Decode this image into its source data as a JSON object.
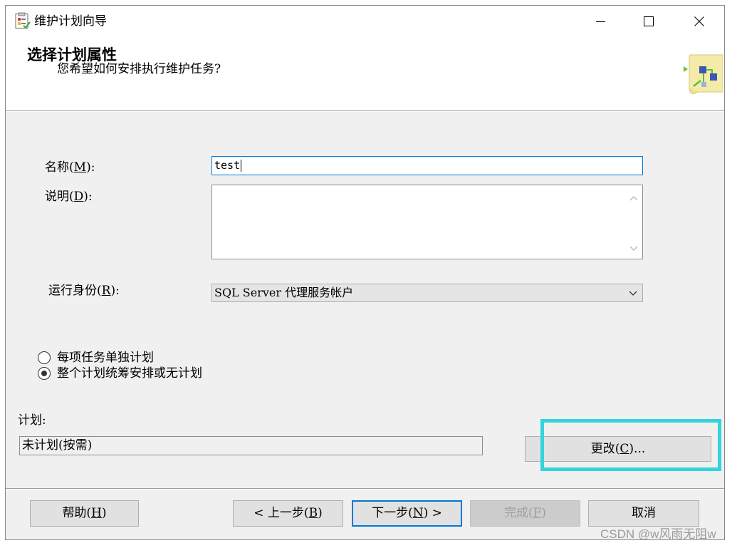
{
  "window": {
    "title": "维护计划向导"
  },
  "header": {
    "title": "选择计划属性",
    "subtitle": "您希望如何安排执行维护任务?"
  },
  "form": {
    "name_label": "名称(M):",
    "name_value": "test",
    "description_label": "说明(D):",
    "description_value": "",
    "run_as_label": "运行身份(R):",
    "run_as_value": "SQL Server 代理服务帐户",
    "schedule_options": [
      {
        "label": "每项任务单独计划",
        "selected": false
      },
      {
        "label": "整个计划统筹安排或无计划",
        "selected": true
      }
    ],
    "schedule_label": "计划:",
    "schedule_value": "未计划(按需)",
    "change_button": "更改(C)..."
  },
  "footer": {
    "help": "帮助(H)",
    "back": "< 上一步(B)",
    "next": "下一步(N) >",
    "finish": "完成(F)",
    "finish_enabled": false,
    "cancel": "取消"
  },
  "watermark": "CSDN @w风雨无阻w",
  "icons": {
    "app": "maintenance-plan-icon",
    "banner": "wizard-banner-icon",
    "minimize": "minimize-icon",
    "maximize": "maximize-icon",
    "close": "close-icon",
    "scroll_up": "chevron-up-icon",
    "scroll_down": "chevron-down-icon",
    "dropdown": "chevron-down-icon"
  },
  "colors": {
    "accent": "#0078d7",
    "annotation": "#33d4da",
    "disabled_text": "#a0a0a0",
    "face": "#f0f0f0"
  }
}
